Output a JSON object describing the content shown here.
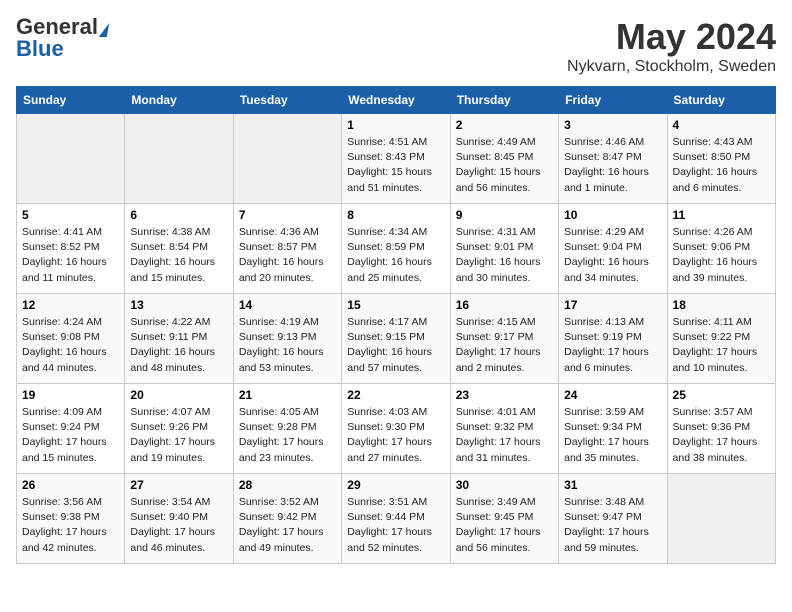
{
  "logo": {
    "general": "General",
    "blue": "Blue"
  },
  "title": "May 2024",
  "location": "Nykvarn, Stockholm, Sweden",
  "days_of_week": [
    "Sunday",
    "Monday",
    "Tuesday",
    "Wednesday",
    "Thursday",
    "Friday",
    "Saturday"
  ],
  "weeks": [
    [
      {
        "day": "",
        "sunrise": "",
        "sunset": "",
        "daylight": ""
      },
      {
        "day": "",
        "sunrise": "",
        "sunset": "",
        "daylight": ""
      },
      {
        "day": "",
        "sunrise": "",
        "sunset": "",
        "daylight": ""
      },
      {
        "day": "1",
        "sunrise": "Sunrise: 4:51 AM",
        "sunset": "Sunset: 8:43 PM",
        "daylight": "Daylight: 15 hours and 51 minutes."
      },
      {
        "day": "2",
        "sunrise": "Sunrise: 4:49 AM",
        "sunset": "Sunset: 8:45 PM",
        "daylight": "Daylight: 15 hours and 56 minutes."
      },
      {
        "day": "3",
        "sunrise": "Sunrise: 4:46 AM",
        "sunset": "Sunset: 8:47 PM",
        "daylight": "Daylight: 16 hours and 1 minute."
      },
      {
        "day": "4",
        "sunrise": "Sunrise: 4:43 AM",
        "sunset": "Sunset: 8:50 PM",
        "daylight": "Daylight: 16 hours and 6 minutes."
      }
    ],
    [
      {
        "day": "5",
        "sunrise": "Sunrise: 4:41 AM",
        "sunset": "Sunset: 8:52 PM",
        "daylight": "Daylight: 16 hours and 11 minutes."
      },
      {
        "day": "6",
        "sunrise": "Sunrise: 4:38 AM",
        "sunset": "Sunset: 8:54 PM",
        "daylight": "Daylight: 16 hours and 15 minutes."
      },
      {
        "day": "7",
        "sunrise": "Sunrise: 4:36 AM",
        "sunset": "Sunset: 8:57 PM",
        "daylight": "Daylight: 16 hours and 20 minutes."
      },
      {
        "day": "8",
        "sunrise": "Sunrise: 4:34 AM",
        "sunset": "Sunset: 8:59 PM",
        "daylight": "Daylight: 16 hours and 25 minutes."
      },
      {
        "day": "9",
        "sunrise": "Sunrise: 4:31 AM",
        "sunset": "Sunset: 9:01 PM",
        "daylight": "Daylight: 16 hours and 30 minutes."
      },
      {
        "day": "10",
        "sunrise": "Sunrise: 4:29 AM",
        "sunset": "Sunset: 9:04 PM",
        "daylight": "Daylight: 16 hours and 34 minutes."
      },
      {
        "day": "11",
        "sunrise": "Sunrise: 4:26 AM",
        "sunset": "Sunset: 9:06 PM",
        "daylight": "Daylight: 16 hours and 39 minutes."
      }
    ],
    [
      {
        "day": "12",
        "sunrise": "Sunrise: 4:24 AM",
        "sunset": "Sunset: 9:08 PM",
        "daylight": "Daylight: 16 hours and 44 minutes."
      },
      {
        "day": "13",
        "sunrise": "Sunrise: 4:22 AM",
        "sunset": "Sunset: 9:11 PM",
        "daylight": "Daylight: 16 hours and 48 minutes."
      },
      {
        "day": "14",
        "sunrise": "Sunrise: 4:19 AM",
        "sunset": "Sunset: 9:13 PM",
        "daylight": "Daylight: 16 hours and 53 minutes."
      },
      {
        "day": "15",
        "sunrise": "Sunrise: 4:17 AM",
        "sunset": "Sunset: 9:15 PM",
        "daylight": "Daylight: 16 hours and 57 minutes."
      },
      {
        "day": "16",
        "sunrise": "Sunrise: 4:15 AM",
        "sunset": "Sunset: 9:17 PM",
        "daylight": "Daylight: 17 hours and 2 minutes."
      },
      {
        "day": "17",
        "sunrise": "Sunrise: 4:13 AM",
        "sunset": "Sunset: 9:19 PM",
        "daylight": "Daylight: 17 hours and 6 minutes."
      },
      {
        "day": "18",
        "sunrise": "Sunrise: 4:11 AM",
        "sunset": "Sunset: 9:22 PM",
        "daylight": "Daylight: 17 hours and 10 minutes."
      }
    ],
    [
      {
        "day": "19",
        "sunrise": "Sunrise: 4:09 AM",
        "sunset": "Sunset: 9:24 PM",
        "daylight": "Daylight: 17 hours and 15 minutes."
      },
      {
        "day": "20",
        "sunrise": "Sunrise: 4:07 AM",
        "sunset": "Sunset: 9:26 PM",
        "daylight": "Daylight: 17 hours and 19 minutes."
      },
      {
        "day": "21",
        "sunrise": "Sunrise: 4:05 AM",
        "sunset": "Sunset: 9:28 PM",
        "daylight": "Daylight: 17 hours and 23 minutes."
      },
      {
        "day": "22",
        "sunrise": "Sunrise: 4:03 AM",
        "sunset": "Sunset: 9:30 PM",
        "daylight": "Daylight: 17 hours and 27 minutes."
      },
      {
        "day": "23",
        "sunrise": "Sunrise: 4:01 AM",
        "sunset": "Sunset: 9:32 PM",
        "daylight": "Daylight: 17 hours and 31 minutes."
      },
      {
        "day": "24",
        "sunrise": "Sunrise: 3:59 AM",
        "sunset": "Sunset: 9:34 PM",
        "daylight": "Daylight: 17 hours and 35 minutes."
      },
      {
        "day": "25",
        "sunrise": "Sunrise: 3:57 AM",
        "sunset": "Sunset: 9:36 PM",
        "daylight": "Daylight: 17 hours and 38 minutes."
      }
    ],
    [
      {
        "day": "26",
        "sunrise": "Sunrise: 3:56 AM",
        "sunset": "Sunset: 9:38 PM",
        "daylight": "Daylight: 17 hours and 42 minutes."
      },
      {
        "day": "27",
        "sunrise": "Sunrise: 3:54 AM",
        "sunset": "Sunset: 9:40 PM",
        "daylight": "Daylight: 17 hours and 46 minutes."
      },
      {
        "day": "28",
        "sunrise": "Sunrise: 3:52 AM",
        "sunset": "Sunset: 9:42 PM",
        "daylight": "Daylight: 17 hours and 49 minutes."
      },
      {
        "day": "29",
        "sunrise": "Sunrise: 3:51 AM",
        "sunset": "Sunset: 9:44 PM",
        "daylight": "Daylight: 17 hours and 52 minutes."
      },
      {
        "day": "30",
        "sunrise": "Sunrise: 3:49 AM",
        "sunset": "Sunset: 9:45 PM",
        "daylight": "Daylight: 17 hours and 56 minutes."
      },
      {
        "day": "31",
        "sunrise": "Sunrise: 3:48 AM",
        "sunset": "Sunset: 9:47 PM",
        "daylight": "Daylight: 17 hours and 59 minutes."
      },
      {
        "day": "",
        "sunrise": "",
        "sunset": "",
        "daylight": ""
      }
    ]
  ]
}
